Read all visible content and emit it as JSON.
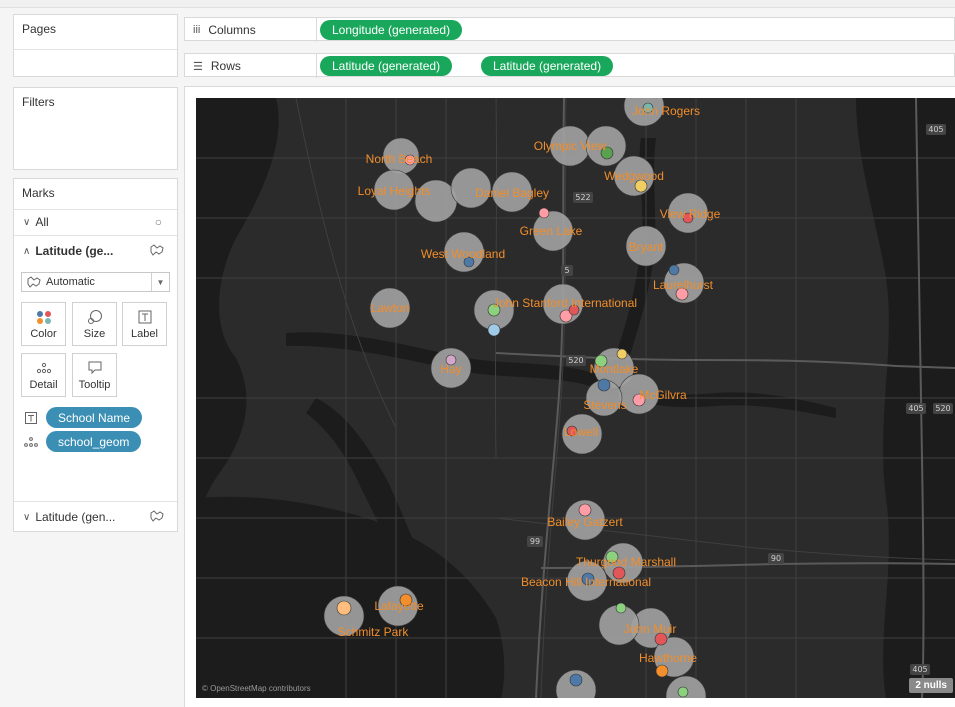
{
  "left": {
    "pages_title": "Pages",
    "filters_title": "Filters",
    "marks": {
      "title": "Marks",
      "all_label": "All",
      "layer1_label": "Latitude (ge...",
      "mark_type": "Automatic",
      "buttons": [
        {
          "label": "Color",
          "icon": "color-dots-icon"
        },
        {
          "label": "Size",
          "icon": "size-icon"
        },
        {
          "label": "Label",
          "icon": "label-icon"
        },
        {
          "label": "Detail",
          "icon": "detail-icon"
        },
        {
          "label": "Tooltip",
          "icon": "tooltip-icon"
        }
      ],
      "fields": [
        {
          "label": "School Name",
          "icon": "T"
        },
        {
          "label": "school_geom",
          "icon": "detail-dots"
        }
      ],
      "layer2_label": "Latitude (gen..."
    }
  },
  "shelves": {
    "columns_label": "Columns",
    "columns_pills": [
      "Longitude (generated)"
    ],
    "rows_label": "Rows",
    "rows_pills": [
      "Latitude (generated)",
      "Latitude (generated)"
    ]
  },
  "map": {
    "attribution": "© OpenStreetMap contributors",
    "nulls": "2 nulls",
    "label_color": "#f28e2b",
    "highway_labels": [
      "405",
      "405",
      "520",
      "522",
      "5",
      "520",
      "99",
      "90",
      "405"
    ],
    "schools": [
      {
        "name": "John Rogers"
      },
      {
        "name": "Olympic View"
      },
      {
        "name": "North Beach"
      },
      {
        "name": "Wedgwood"
      },
      {
        "name": "Loyal Heights"
      },
      {
        "name": "Daniel Bagley"
      },
      {
        "name": "View Ridge"
      },
      {
        "name": "Green Lake"
      },
      {
        "name": "Bryant"
      },
      {
        "name": "West Woodland"
      },
      {
        "name": "Laurelhurst"
      },
      {
        "name": "Lawton"
      },
      {
        "name": "John Stanford International"
      },
      {
        "name": "Hay"
      },
      {
        "name": "Montlake"
      },
      {
        "name": "McGilvra"
      },
      {
        "name": "Stevens"
      },
      {
        "name": "Lowell"
      },
      {
        "name": "Bailey Gatzert"
      },
      {
        "name": "Thurgood Marshall"
      },
      {
        "name": "Beacon Hill International"
      },
      {
        "name": "Lafayette"
      },
      {
        "name": "Schmitz Park"
      },
      {
        "name": "John Muir"
      },
      {
        "name": "Hawthorne"
      }
    ]
  }
}
